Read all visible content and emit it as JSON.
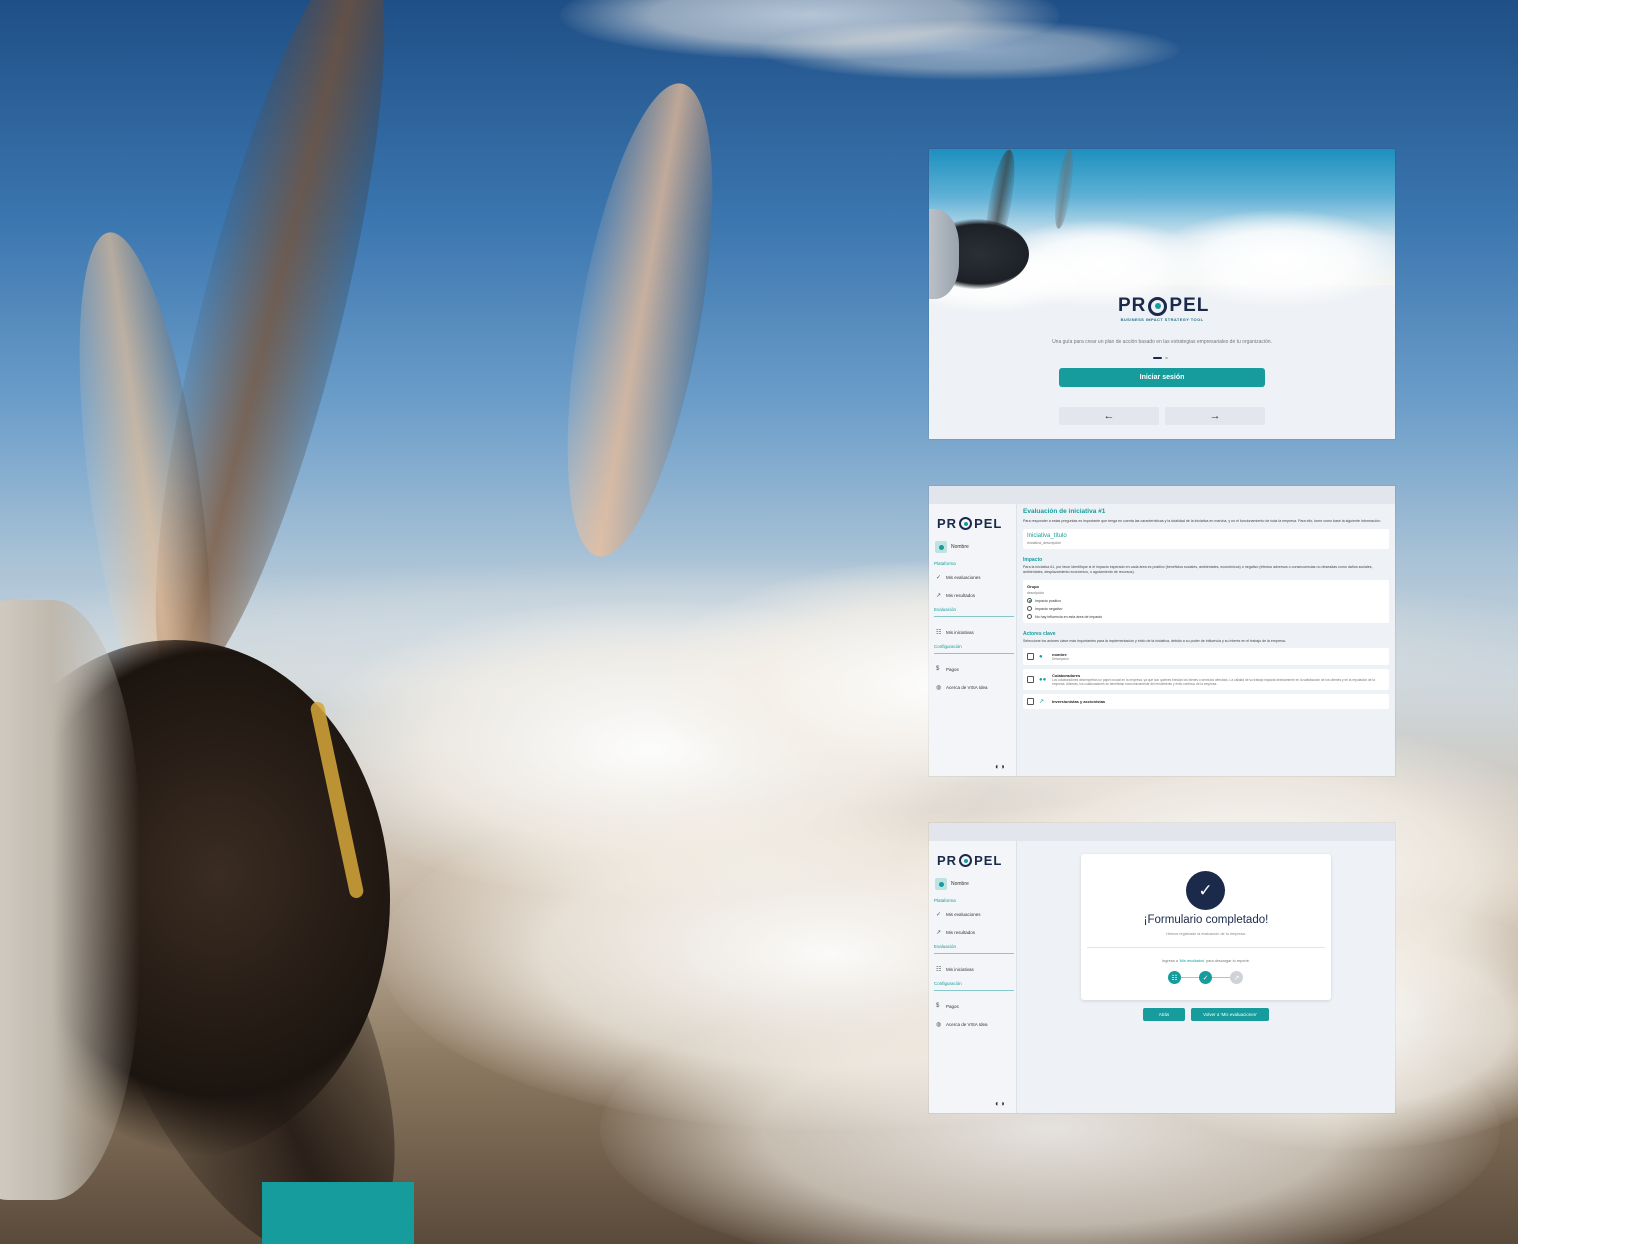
{
  "colors": {
    "brand_teal": "#179c9e",
    "brand_navy": "#1b2a4a",
    "panel_bg": "#eef1f5"
  },
  "brand": {
    "name_left": "PR",
    "name_right": "PEL",
    "tagline": "BUSINESS IMPACT STRATEGY TOOL"
  },
  "screen1": {
    "description": "Una guía para crear un plan de acción basado en las estrategias empresariales de tu organización.",
    "login_label": "Iniciar sesión",
    "prev_icon": "arrow-left-icon",
    "next_icon": "arrow-right-icon"
  },
  "sidebar": {
    "user_name": "Nombre",
    "section_platform": "Plataforma",
    "item_evaluations": "Mis evaluaciones",
    "item_results": "Mis resultados",
    "section_evaluation": "Evaluación",
    "item_initiatives": "Mis iniciativas",
    "section_config": "Configuración",
    "item_payments": "Pagos",
    "item_about": "Acerca de VISA Idea"
  },
  "screen2": {
    "title": "Evaluación de iniciativa #1",
    "intro": "Para responder a estas preguntas es importante que tenga en cuenta las características y la totalidad de la iniciativa en marcha, y no el funcionamiento de toda la empresa. Para ello, tome como base la siguiente información:",
    "card_title": "Iniciativa_título",
    "card_desc": "Iniciativa_descripción",
    "impact_heading": "Impacto",
    "impact_text": "Para la iniciativa #1, por favor identifique si el impacto esperado en cada área es positivo (beneficios sociales, ambientales, económicos) o negativo (efectos adversos o consecuencias no deseadas como daños sociales, ambientales, desplazamiento económico, o agotamiento de recursos).",
    "area_label": "Grupo",
    "area_desc": "descripción",
    "options": [
      "Impacto positivo",
      "Impacto negativo",
      "No hay influencia en esta área de impacto"
    ],
    "actors_heading": "Actores clave",
    "actors_text": "Seleccione los actores clave más importantes para la implementación y éxito de la iniciativa, debido a su poder de influencia y su interés en el trabajo de la empresa.",
    "actors": [
      {
        "name": "nombre",
        "desc": "Descripción"
      },
      {
        "name": "Colaboradores",
        "desc": "Los colaboradores desempeñan un papel crucial en la empresa, ya que son quienes brindan los bienes o servicios ofrecidos. La calidad de su trabajo impacta directamente en la satisfacción de los clientes y en la reputación de la empresa. Además, los colaboradores se benefician económicamente del rendimiento y éxito continuo de la empresa."
      },
      {
        "name": "Inversionistas y accionistas",
        "desc": ""
      }
    ]
  },
  "screen3": {
    "title": "¡Formulario completado!",
    "subtitle": "Hemos registrado la evaluación de tu empresa.",
    "hint_pre": "Ingresa a ",
    "hint_link": "'Mis resultados'",
    "hint_post": " para descargar tu reporte.",
    "btn_back": "Atrás",
    "btn_return": "Volver a 'Mis evaluaciones'"
  }
}
